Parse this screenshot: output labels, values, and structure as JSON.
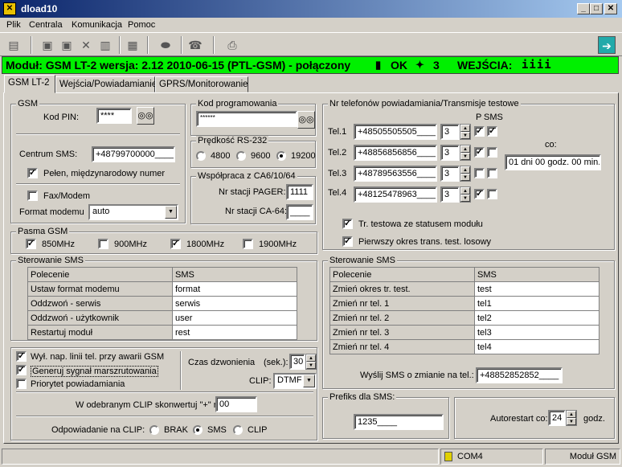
{
  "window": {
    "title": "dload10"
  },
  "menu": [
    "Plik",
    "Centrala",
    "Komunikacja",
    "Pomoc"
  ],
  "status": {
    "module": "Moduł: GSM LT-2 wersja: 2.12 2010-06-15 (PTL-GSM) -  połączony",
    "ok": "OK",
    "signal": "3",
    "inputs_label": "WEJŚCIA:",
    "inputs_value": "iiii"
  },
  "tabs": [
    "GSM LT-2",
    "Wejścia/Powiadamianie",
    "GPRS/Monitorowanie"
  ],
  "gsm": {
    "legend": "GSM",
    "pin_label": "Kod PIN:",
    "pin_value": "****",
    "sms_center_label": "Centrum SMS:",
    "sms_center_value": "+48799700000____",
    "intl_label": "Pełen, międzynarodowy numer",
    "fax_label": "Fax/Modem",
    "modem_format_label": "Format modemu",
    "modem_format_value": "auto"
  },
  "prog": {
    "legend": "Kod programowania",
    "value": "******"
  },
  "rs232": {
    "legend": "Prędkość RS-232",
    "options": [
      "4800",
      "9600",
      "19200"
    ]
  },
  "ca6": {
    "legend": "Współpraca z CA6/10/64",
    "pager_label": "Nr stacji PAGER:",
    "pager_value": "1111",
    "ca64_label": "Nr stacji CA-64:",
    "ca64_value": "____"
  },
  "phones": {
    "legend": "Nr telefonów powiadamiania/Transmisje testowe",
    "p_header": "P",
    "sms_header": "SMS",
    "co_label": "co:",
    "co_value": "01 dni 00 godz. 00 min.",
    "rows": [
      {
        "label": "Tel.1",
        "number": "+48505505505____",
        "n": "3"
      },
      {
        "label": "Tel.2",
        "number": "+48856856856____",
        "n": "3"
      },
      {
        "label": "Tel.3",
        "number": "+48789563556____",
        "n": "3"
      },
      {
        "label": "Tel.4",
        "number": "+48125478963____",
        "n": "3"
      }
    ],
    "test_status_label": "Tr. testowa ze statusem modułu",
    "first_random_label": "Pierwszy okres trans. test. losowy"
  },
  "bands": {
    "legend": "Pasma GSM",
    "items": [
      "850MHz",
      "900MHz",
      "1800MHz",
      "1900MHz"
    ]
  },
  "sms_ctrl_left": {
    "legend": "Sterowanie SMS",
    "headers": [
      "Polecenie",
      "SMS"
    ],
    "rows": [
      [
        "Ustaw format modemu",
        "format"
      ],
      [
        "Oddzwoń - serwis",
        "serwis"
      ],
      [
        "Oddzwoń - użytkownik",
        "user"
      ],
      [
        "Restartuj moduł",
        "rest"
      ]
    ]
  },
  "sms_ctrl_right": {
    "legend": "Sterowanie SMS",
    "headers": [
      "Polecenie",
      "SMS"
    ],
    "rows": [
      [
        "Zmień okres tr. test.",
        "test"
      ],
      [
        "Zmień nr tel. 1",
        "tel1"
      ],
      [
        "Zmień nr tel. 2",
        "tel2"
      ],
      [
        "Zmień nr tel. 3",
        "tel3"
      ],
      [
        "Zmień nr tel. 4",
        "tel4"
      ]
    ],
    "send_label": "Wyślij SMS o zmianie na tel.:",
    "send_value": "+48852852852____"
  },
  "options": {
    "gsm_fail_label": "Wył. nap. linii tel. przy awarii GSM",
    "route_signal_label": "Generuj sygnał marszrutowania",
    "priority_label": "Priorytet powiadamiania",
    "ring_label": "Czas dzwonienia",
    "ring_unit": "(sek.):",
    "ring_value": "30",
    "clip_label": "CLIP:",
    "clip_value": "DTMF",
    "convert_label": "W odebranym CLIP skonwertuj \"+\" na:",
    "convert_value": "00",
    "answer_label": "Odpowiadanie na CLIP:",
    "answer_options": [
      "BRAK",
      "SMS",
      "CLIP"
    ]
  },
  "prefix": {
    "legend": "Prefiks dla SMS:",
    "value": "1235____"
  },
  "autorestart": {
    "label": "Autorestart co:",
    "value": "24",
    "unit": "godz."
  },
  "statusbar": {
    "port": "COM4",
    "device": "Moduł GSM"
  }
}
